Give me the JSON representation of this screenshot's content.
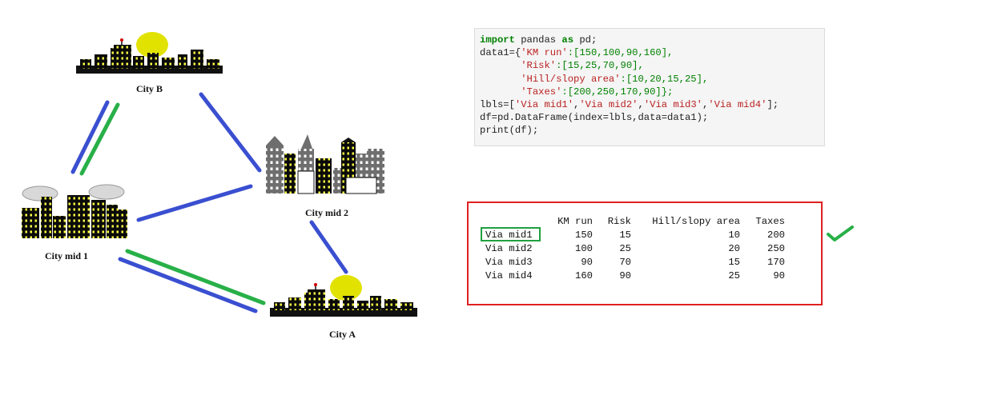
{
  "cities": {
    "city_b": "City B",
    "city_mid2": "City mid 2",
    "city_mid1": "City mid 1",
    "city_a": "City A"
  },
  "code": {
    "line1_kw1": "import",
    "line1_mid": " pandas ",
    "line1_kw2": "as",
    "line1_end": " pd;",
    "line2_pre": "data1={",
    "key_km": "'KM run'",
    "vals_km": ":[150,100,90,160],",
    "key_risk": "'Risk'",
    "vals_risk": ":[15,25,70,90],",
    "key_hill": "'Hill/slopy area'",
    "vals_hill": ":[10,20,15,25],",
    "key_tax": "'Taxes'",
    "vals_tax": ":[200,250,170,90]};",
    "lbls_pre": "lbls=[",
    "lbl1": "'Via mid1'",
    "lbl2": "'Via mid2'",
    "lbl3": "'Via mid3'",
    "lbl4": "'Via mid4'",
    "lbls_end": "];",
    "df_line": "df=pd.DataFrame(index=lbls,data=data1);",
    "print_line": "print(df);"
  },
  "output": {
    "columns": [
      "KM run",
      "Risk",
      "Hill/slopy area",
      "Taxes"
    ],
    "rows": [
      {
        "index": "Via mid1",
        "values": [
          "150",
          "15",
          "10",
          "200"
        ]
      },
      {
        "index": "Via mid2",
        "values": [
          "100",
          "25",
          "20",
          "250"
        ]
      },
      {
        "index": "Via mid3",
        "values": [
          "90",
          "70",
          "15",
          "170"
        ]
      },
      {
        "index": "Via mid4",
        "values": [
          "160",
          "90",
          "25",
          "90"
        ]
      }
    ]
  },
  "colors": {
    "route_blue": "#3a4fd0",
    "route_green": "#28b048",
    "output_border": "#e02020",
    "highlight": "#20a040",
    "sun": "#e2e200"
  }
}
